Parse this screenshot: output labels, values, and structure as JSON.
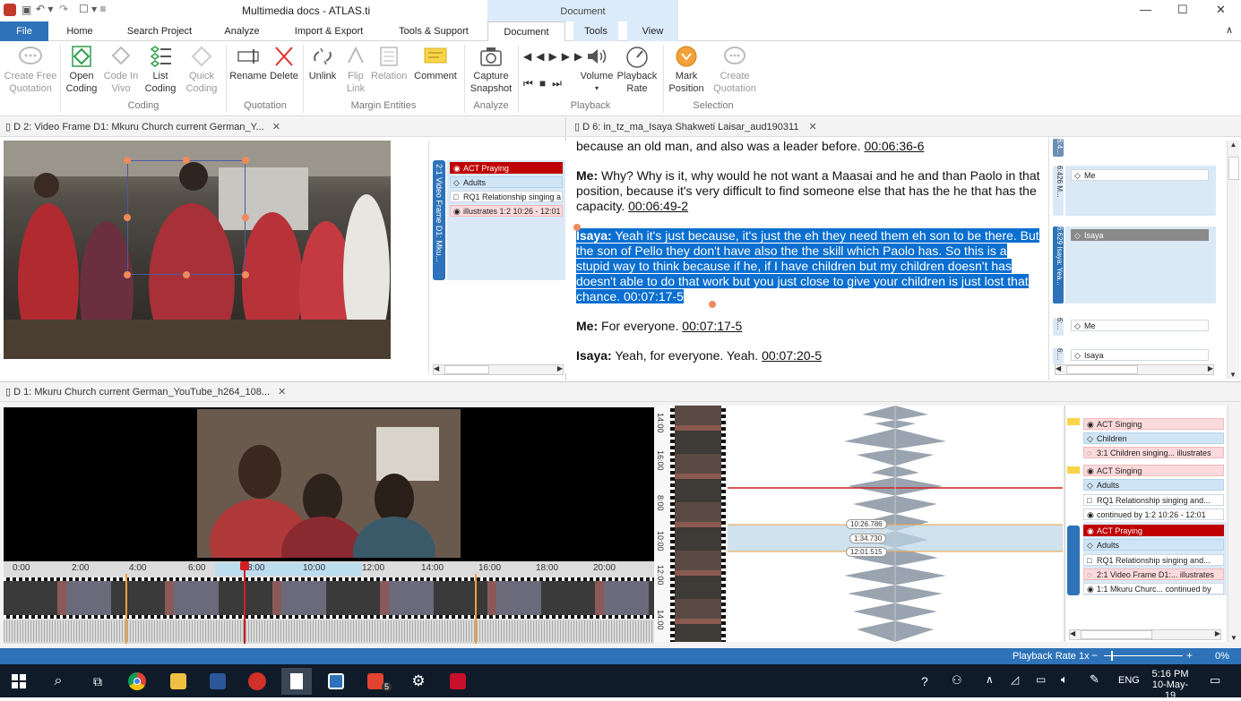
{
  "titlebar": {
    "title": "Multimedia docs - ATLAS.ti",
    "context_tab": "Document",
    "minimize": "—",
    "maximize": "☐",
    "close": "✕"
  },
  "ribbon_tabs": [
    "File",
    "Home",
    "Search Project",
    "Analyze",
    "Import & Export",
    "Tools & Support",
    "Document",
    "Tools",
    "View"
  ],
  "ribbon": {
    "create_free_quotation": "Create Free Quotation",
    "open_coding": "Open Coding",
    "code_in_vivo": "Code In Vivo",
    "list_coding": "List Coding",
    "quick_coding": "Quick Coding",
    "group_coding": "Coding",
    "rename": "Rename",
    "delete": "Delete",
    "group_quotation": "Quotation",
    "unlink": "Unlink",
    "flip_link": "Flip Link",
    "relation": "Relation",
    "comment": "Comment",
    "group_margin": "Margin Entities",
    "capture_snapshot": "Capture Snapshot",
    "group_analyze": "Analyze",
    "volume": "Volume",
    "playback_rate": "Playback Rate",
    "group_playback": "Playback",
    "mark_position": "Mark Position",
    "create_quotation": "Create Quotation",
    "group_selection": "Selection"
  },
  "doc_video_frame": {
    "tab": "D 2: Video Frame D1: Mkuru Church current German_Y...",
    "margin_vertical": "2:1 Video Frame D1: Mku...",
    "codes": [
      "ACT Praying",
      "Adults",
      "RQ1 Relationship singing a",
      "illustrates 1:2 10:26 - 12:01"
    ]
  },
  "doc_transcript": {
    "tab": "D 6: in_tz_ma_Isaya Shakweti Laisar_aud190311",
    "paragraphs": [
      {
        "speaker": "",
        "text": "because an old man, and also was a leader before. ",
        "time": "00:06:36-6"
      },
      {
        "speaker": "Me:",
        "text": " Why? Why is it, why would he not want a Maasai and he and than Paolo in that position, because it's very difficult to find someone else that has the he that has the capacity. ",
        "time": "00:06:49-2"
      },
      {
        "speaker": "Isaya:",
        "text": " Yeah it's just because, it's just the eh they need them eh son to be there. But the son of Pello they don't have also the the skill which Paolo has. So this is a stupid way to think because if he, if I have children but my children doesn't has doesn't able to do that work but you just close to give your children is just lost that chance. ",
        "time": "00:07:17-5"
      },
      {
        "speaker": "Me:",
        "text": " For everyone. ",
        "time": "00:07:17-5"
      },
      {
        "speaker": "Isaya:",
        "text": " Yeah, for everyone. Yeah. ",
        "time": "00:07:20-5"
      }
    ],
    "margin_labels": [
      "6:4...",
      "6:426 M...",
      "6:629 Isaya: Yea...",
      "6:...",
      "6:..."
    ],
    "margin_codes": [
      "Me",
      "Isaya",
      "Me",
      "Isaya"
    ]
  },
  "doc_video": {
    "tab": "D 1: Mkuru Church current German_YouTube_h264_108...",
    "timeline": [
      "0:00",
      "2:00",
      "4:00",
      "6:00",
      "8:00",
      "10:00",
      "12:00",
      "14:00",
      "16:00",
      "18:00",
      "20:00"
    ],
    "vertical_times": [
      "14:00",
      "16:00",
      "8:00",
      "10:00",
      "12:00",
      "14:00"
    ],
    "range_labels": [
      "10:26.786",
      "1:34.730",
      "12:01.515"
    ],
    "codes": [
      {
        "text": "ACT Singing",
        "style": "qpink",
        "icon": "◉"
      },
      {
        "text": "Children",
        "style": "qblue",
        "icon": "◇"
      },
      {
        "text": "3:1 Children singing...  illustrates",
        "style": "qpink",
        "icon": "◌"
      },
      {
        "text": "ACT Singing",
        "style": "qpink",
        "icon": "◉"
      },
      {
        "text": "Adults",
        "style": "qblue",
        "icon": "◇"
      },
      {
        "text": "RQ1 Relationship singing and...",
        "style": "",
        "icon": "□"
      },
      {
        "text": "continued by 1:2 10:26 - 12:01",
        "style": "",
        "icon": "◉"
      },
      {
        "text": "ACT Praying",
        "style": "qred",
        "icon": "◉"
      },
      {
        "text": "Adults",
        "style": "qblue",
        "icon": "◇"
      },
      {
        "text": "RQ1 Relationship singing and...",
        "style": "",
        "icon": "□"
      },
      {
        "text": "2:1 Video Frame D1:...  illustrates",
        "style": "qpink",
        "icon": "◌"
      },
      {
        "text": "1:1 Mkuru Churc...  continued by",
        "style": "",
        "icon": "◉"
      }
    ]
  },
  "statusbar": {
    "playback_rate": "Playback Rate 1x",
    "zoom": "0%"
  },
  "taskbar": {
    "lang": "ENG",
    "time": "5:16 PM",
    "date": "10-May-19",
    "badge": "5"
  }
}
